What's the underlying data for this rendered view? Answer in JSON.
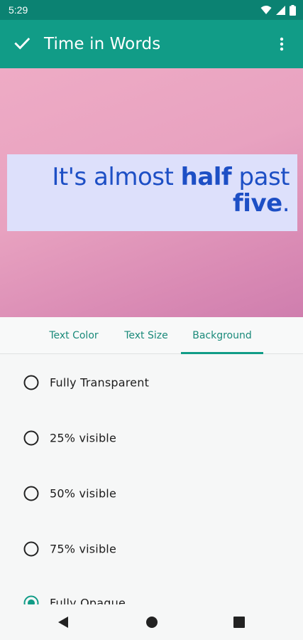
{
  "status_bar": {
    "time": "5:29",
    "icons": [
      "wifi-icon",
      "signal-icon",
      "battery-icon"
    ]
  },
  "app_bar": {
    "title": "Time in Words",
    "confirm_icon": "check-icon",
    "menu_icon": "overflow-menu-icon"
  },
  "preview": {
    "text_line1_prefix": "It's almost ",
    "text_line1_bold": "half",
    "text_line1_suffix": " past",
    "text_line2_bold": "five",
    "text_line2_suffix": ".",
    "text_color": "#1d4fc5",
    "box_color": "#dde0fb"
  },
  "tabs": [
    {
      "label": "Text Color",
      "selected": false
    },
    {
      "label": "Text Size",
      "selected": false
    },
    {
      "label": "Background",
      "selected": true
    }
  ],
  "options": [
    {
      "label": "Fully Transparent",
      "selected": false
    },
    {
      "label": "25% visible",
      "selected": false
    },
    {
      "label": "50% visible",
      "selected": false
    },
    {
      "label": "75% visible",
      "selected": false
    },
    {
      "label": "Fully Opaque",
      "selected": true
    }
  ],
  "colors": {
    "accent": "#119c87",
    "status_bar": "#0b8272"
  },
  "nav_bar": {
    "icons": [
      "back-icon",
      "home-icon",
      "recents-icon"
    ]
  }
}
